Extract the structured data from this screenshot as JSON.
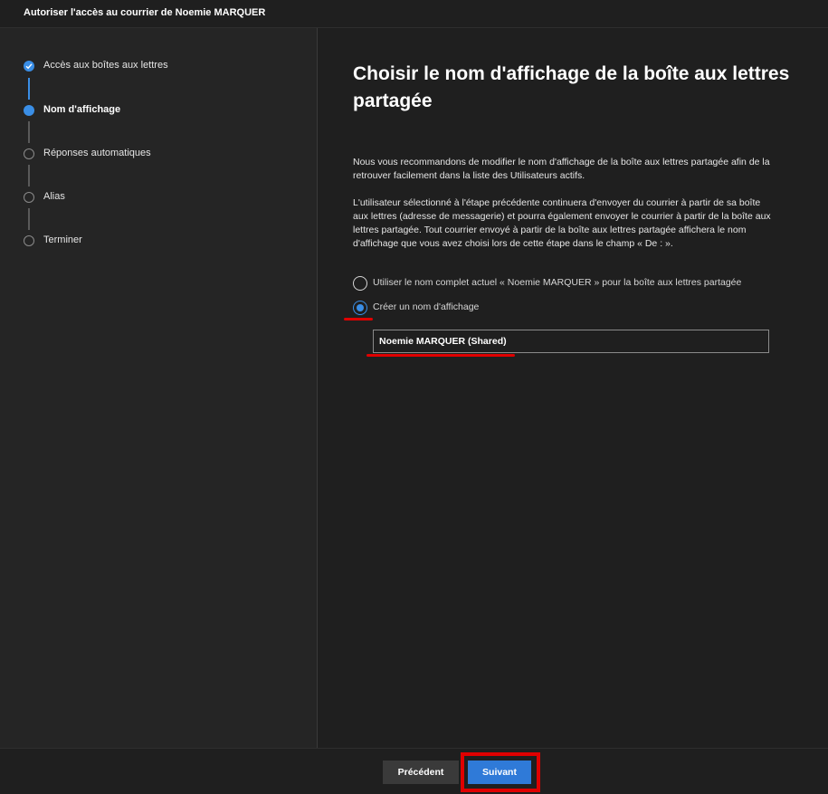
{
  "window": {
    "title": "Autoriser l'accès au courrier de Noemie MARQUER"
  },
  "steps": [
    {
      "label": "Accès aux boîtes aux lettres",
      "state": "done"
    },
    {
      "label": "Nom d'affichage",
      "state": "current"
    },
    {
      "label": "Réponses automatiques",
      "state": "todo"
    },
    {
      "label": "Alias",
      "state": "todo"
    },
    {
      "label": "Terminer",
      "state": "todo"
    }
  ],
  "main": {
    "heading": "Choisir le nom d'affichage de la boîte aux lettres partagée",
    "para1": "Nous vous recommandons de modifier le nom d'affichage de la boîte aux lettres partagée afin de la retrouver facilement dans la liste des Utilisateurs actifs.",
    "para2": "L'utilisateur sélectionné à l'étape précédente continuera d'envoyer du courrier à partir de sa boîte aux lettres (adresse de messagerie) et pourra également envoyer le courrier à partir de la boîte aux lettres partagée. Tout courrier envoyé à partir de la boîte aux lettres partagée affichera le nom d'affichage que vous avez choisi lors de cette étape dans le champ « De : ».",
    "options": [
      {
        "label": "Utiliser le nom complet actuel « Noemie MARQUER » pour la boîte aux lettres partagée",
        "selected": false
      },
      {
        "label": "Créer un nom d'affichage",
        "selected": true
      }
    ],
    "display_name_value": "Noemie MARQUER (Shared)"
  },
  "footer": {
    "previous_label": "Précédent",
    "next_label": "Suivant"
  },
  "colors": {
    "accent": "#3a8ee6",
    "annotation": "#e00000",
    "background": "#1f1f1f",
    "sidebar": "#252525"
  }
}
